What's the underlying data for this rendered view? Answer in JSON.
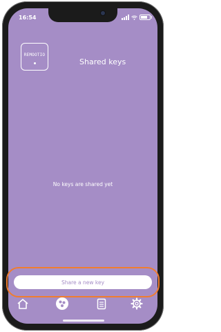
{
  "status_bar": {
    "time": "16:54"
  },
  "brand": {
    "logo_text": "REMOOTIO"
  },
  "page": {
    "title": "Shared keys",
    "empty_message": "No keys are shared yet"
  },
  "actions": {
    "share_button": "Share a new key"
  },
  "tabbar": {
    "items": [
      "home-icon",
      "keys-icon",
      "log-icon",
      "settings-icon"
    ],
    "active": "keys-icon"
  },
  "colors": {
    "background": "#a58dc6",
    "highlight": "#f07d2e",
    "text": "#ffffff"
  }
}
